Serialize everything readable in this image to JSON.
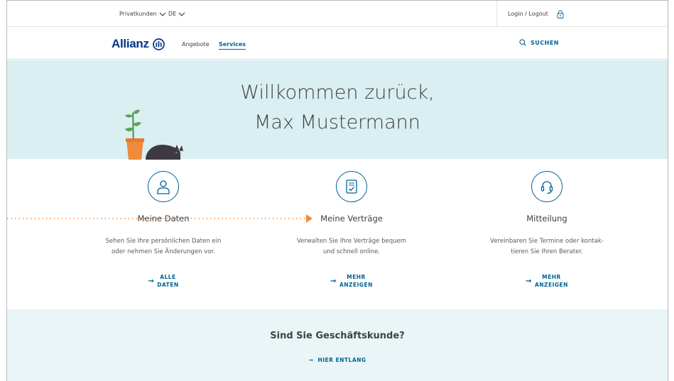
{
  "topbar": {
    "customer_type": "Privatkunden",
    "language": "DE",
    "login_label": "Login / Logout"
  },
  "nav": {
    "brand": "Allianz",
    "links": [
      "Angebote",
      "Services"
    ],
    "active_link": "Services",
    "search_label": "SUCHEN"
  },
  "hero": {
    "line1": "Willkommen zurück,",
    "line2": "Max Mustermann"
  },
  "cards": [
    {
      "icon": "user-icon",
      "title": "Meine Daten",
      "desc_line1": "Sehen Sie Ihre persönlichen Daten ein",
      "desc_line2": "oder nehmen Sie Änderungen vor.",
      "cta_line1": "ALLE",
      "cta_line2": "DATEN"
    },
    {
      "icon": "contract-icon",
      "title": "Meine Verträge",
      "desc_line1": "Verwalten Sie Ihre Verträge bequem",
      "desc_line2": "und schnell online.",
      "cta_line1": "MEHR",
      "cta_line2": "ANZEIGEN"
    },
    {
      "icon": "headset-icon",
      "title": "Mitteilung",
      "desc_line1": "Vereinbaren Sie Termine oder kontak-",
      "desc_line2": "tieren Sie Ihren Berater.",
      "cta_line1": "MEHR",
      "cta_line2": "ANZEIGEN"
    }
  ],
  "business": {
    "question": "Sind Sie Geschäftskunde?",
    "cta": "HIER ENTLANG"
  },
  "colors": {
    "brand_blue": "#003781",
    "link_blue": "#006192",
    "hero_bg": "#daeff2",
    "accent_orange": "#f08a3c"
  }
}
